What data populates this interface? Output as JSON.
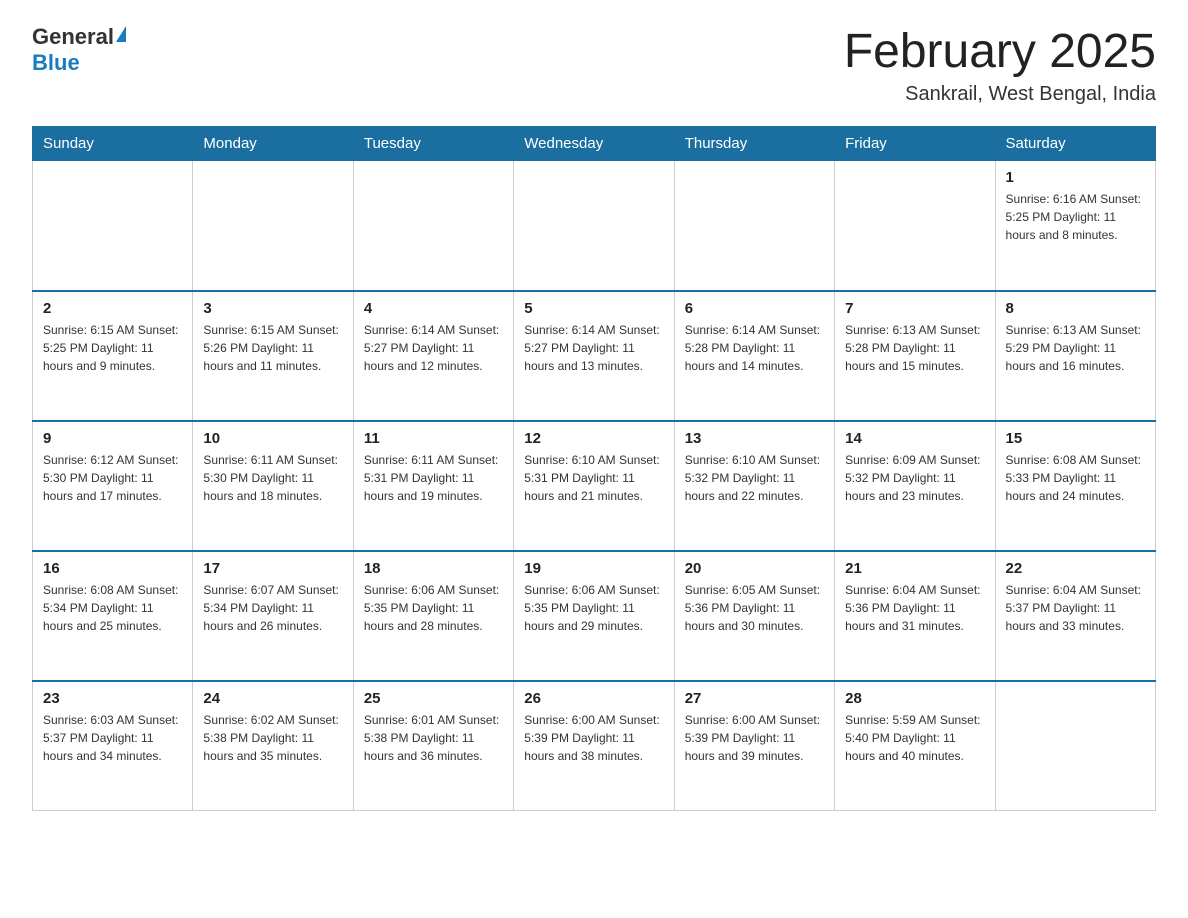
{
  "logo": {
    "general": "General",
    "blue": "Blue"
  },
  "title": "February 2025",
  "subtitle": "Sankrail, West Bengal, India",
  "days_of_week": [
    "Sunday",
    "Monday",
    "Tuesday",
    "Wednesday",
    "Thursday",
    "Friday",
    "Saturday"
  ],
  "weeks": [
    [
      {
        "day": "",
        "info": ""
      },
      {
        "day": "",
        "info": ""
      },
      {
        "day": "",
        "info": ""
      },
      {
        "day": "",
        "info": ""
      },
      {
        "day": "",
        "info": ""
      },
      {
        "day": "",
        "info": ""
      },
      {
        "day": "1",
        "info": "Sunrise: 6:16 AM\nSunset: 5:25 PM\nDaylight: 11 hours and 8 minutes."
      }
    ],
    [
      {
        "day": "2",
        "info": "Sunrise: 6:15 AM\nSunset: 5:25 PM\nDaylight: 11 hours and 9 minutes."
      },
      {
        "day": "3",
        "info": "Sunrise: 6:15 AM\nSunset: 5:26 PM\nDaylight: 11 hours and 11 minutes."
      },
      {
        "day": "4",
        "info": "Sunrise: 6:14 AM\nSunset: 5:27 PM\nDaylight: 11 hours and 12 minutes."
      },
      {
        "day": "5",
        "info": "Sunrise: 6:14 AM\nSunset: 5:27 PM\nDaylight: 11 hours and 13 minutes."
      },
      {
        "day": "6",
        "info": "Sunrise: 6:14 AM\nSunset: 5:28 PM\nDaylight: 11 hours and 14 minutes."
      },
      {
        "day": "7",
        "info": "Sunrise: 6:13 AM\nSunset: 5:28 PM\nDaylight: 11 hours and 15 minutes."
      },
      {
        "day": "8",
        "info": "Sunrise: 6:13 AM\nSunset: 5:29 PM\nDaylight: 11 hours and 16 minutes."
      }
    ],
    [
      {
        "day": "9",
        "info": "Sunrise: 6:12 AM\nSunset: 5:30 PM\nDaylight: 11 hours and 17 minutes."
      },
      {
        "day": "10",
        "info": "Sunrise: 6:11 AM\nSunset: 5:30 PM\nDaylight: 11 hours and 18 minutes."
      },
      {
        "day": "11",
        "info": "Sunrise: 6:11 AM\nSunset: 5:31 PM\nDaylight: 11 hours and 19 minutes."
      },
      {
        "day": "12",
        "info": "Sunrise: 6:10 AM\nSunset: 5:31 PM\nDaylight: 11 hours and 21 minutes."
      },
      {
        "day": "13",
        "info": "Sunrise: 6:10 AM\nSunset: 5:32 PM\nDaylight: 11 hours and 22 minutes."
      },
      {
        "day": "14",
        "info": "Sunrise: 6:09 AM\nSunset: 5:32 PM\nDaylight: 11 hours and 23 minutes."
      },
      {
        "day": "15",
        "info": "Sunrise: 6:08 AM\nSunset: 5:33 PM\nDaylight: 11 hours and 24 minutes."
      }
    ],
    [
      {
        "day": "16",
        "info": "Sunrise: 6:08 AM\nSunset: 5:34 PM\nDaylight: 11 hours and 25 minutes."
      },
      {
        "day": "17",
        "info": "Sunrise: 6:07 AM\nSunset: 5:34 PM\nDaylight: 11 hours and 26 minutes."
      },
      {
        "day": "18",
        "info": "Sunrise: 6:06 AM\nSunset: 5:35 PM\nDaylight: 11 hours and 28 minutes."
      },
      {
        "day": "19",
        "info": "Sunrise: 6:06 AM\nSunset: 5:35 PM\nDaylight: 11 hours and 29 minutes."
      },
      {
        "day": "20",
        "info": "Sunrise: 6:05 AM\nSunset: 5:36 PM\nDaylight: 11 hours and 30 minutes."
      },
      {
        "day": "21",
        "info": "Sunrise: 6:04 AM\nSunset: 5:36 PM\nDaylight: 11 hours and 31 minutes."
      },
      {
        "day": "22",
        "info": "Sunrise: 6:04 AM\nSunset: 5:37 PM\nDaylight: 11 hours and 33 minutes."
      }
    ],
    [
      {
        "day": "23",
        "info": "Sunrise: 6:03 AM\nSunset: 5:37 PM\nDaylight: 11 hours and 34 minutes."
      },
      {
        "day": "24",
        "info": "Sunrise: 6:02 AM\nSunset: 5:38 PM\nDaylight: 11 hours and 35 minutes."
      },
      {
        "day": "25",
        "info": "Sunrise: 6:01 AM\nSunset: 5:38 PM\nDaylight: 11 hours and 36 minutes."
      },
      {
        "day": "26",
        "info": "Sunrise: 6:00 AM\nSunset: 5:39 PM\nDaylight: 11 hours and 38 minutes."
      },
      {
        "day": "27",
        "info": "Sunrise: 6:00 AM\nSunset: 5:39 PM\nDaylight: 11 hours and 39 minutes."
      },
      {
        "day": "28",
        "info": "Sunrise: 5:59 AM\nSunset: 5:40 PM\nDaylight: 11 hours and 40 minutes."
      },
      {
        "day": "",
        "info": ""
      }
    ]
  ]
}
